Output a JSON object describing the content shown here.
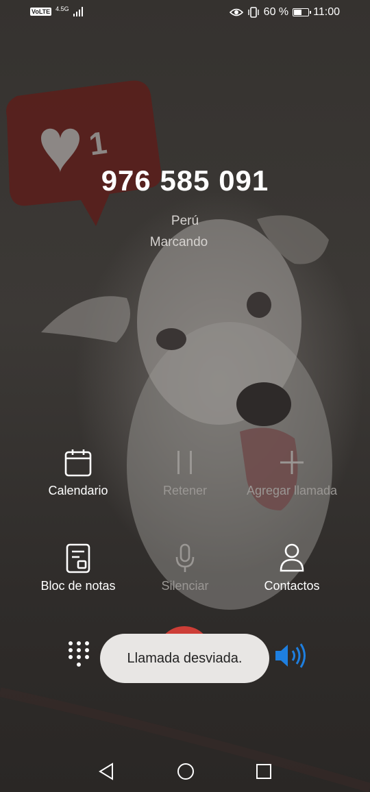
{
  "status_bar": {
    "volte": "VoLTE",
    "network": "4.5G",
    "battery_percent": "60 %",
    "battery_level": 0.6,
    "time": "11:00",
    "icons": [
      "eye-icon",
      "vibrate-icon",
      "signal-icon",
      "battery-icon"
    ]
  },
  "call": {
    "number": "976 585 091",
    "country": "Perú",
    "state": "Marcando"
  },
  "actions": {
    "calendar": "Calendario",
    "hold": "Retener",
    "add_call": "Agregar llamada",
    "notes": "Bloc de notas",
    "mute": "Silenciar",
    "contacts": "Contactos"
  },
  "toast": "Llamada desviada.",
  "colors": {
    "end_call": "#e9423a",
    "speaker": "#1e7fe0",
    "text": "#ffffff",
    "disabled": "#9a9794"
  },
  "nav": [
    "back-icon",
    "home-icon",
    "recents-icon"
  ]
}
